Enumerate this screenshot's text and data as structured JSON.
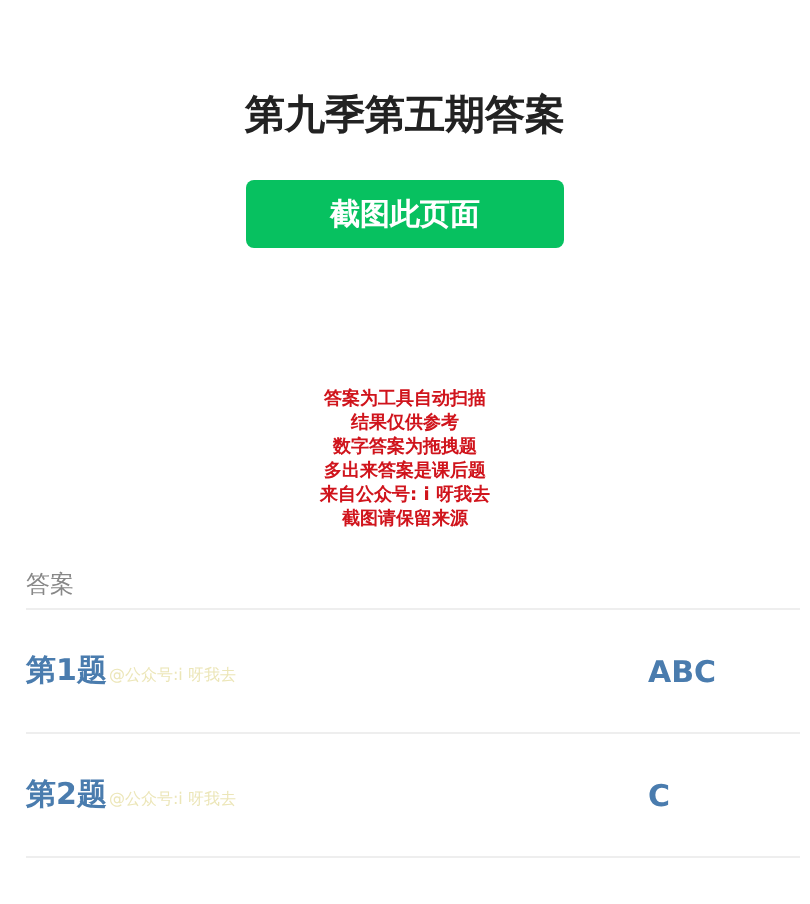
{
  "title": "第九季第五期答案",
  "screenshot_button": "截图此页面",
  "notice_lines": [
    "答案为工具自动扫描",
    "结果仅供参考",
    "数字答案为拖拽题",
    "多出来答案是课后题",
    "来自公众号: i 呀我去",
    "截图请保留来源"
  ],
  "section_label": "答案",
  "answers": [
    {
      "question": "第1题",
      "source": "@公众号:i 呀我去",
      "answer": "ABC"
    },
    {
      "question": "第2题",
      "source": "@公众号:i 呀我去",
      "answer": "C"
    }
  ]
}
